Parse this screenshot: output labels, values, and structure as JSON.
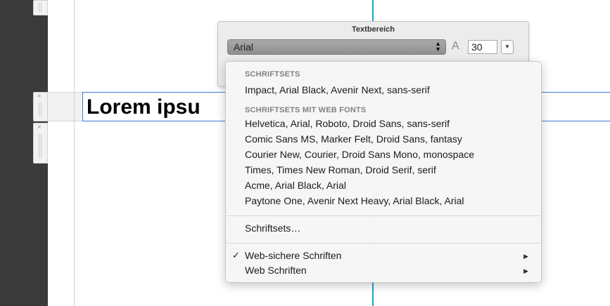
{
  "canvas": {
    "heading_text": "Lorem ipsu"
  },
  "panel": {
    "title": "Textbereich",
    "font_select_value": "Arial",
    "font_size_value": "30"
  },
  "menu": {
    "section1_header": "SCHRIFTSETS",
    "section1_items": [
      "Impact, Arial Black, Avenir Next, sans-serif"
    ],
    "section2_header": "SCHRIFTSETS MIT WEB FONTS",
    "section2_items": [
      "Helvetica, Arial, Roboto, Droid Sans, sans-serif",
      "Comic Sans MS, Marker Felt, Droid Sans, fantasy",
      "Courier New, Courier, Droid Sans Mono, monospace",
      "Times, Times New Roman, Droid Serif, serif",
      "Acme, Arial Black, Arial",
      "Paytone One, Avenir Next Heavy, Arial Black, Arial"
    ],
    "manage_item": "Schriftsets…",
    "submenus": [
      {
        "label": "Web-sichere Schriften",
        "checked": true
      },
      {
        "label": "Web Schriften",
        "checked": false
      }
    ]
  },
  "icons": {
    "close": "×",
    "check": "✓",
    "submenu_arrow": "▶",
    "stepper": "⬍",
    "size": "A"
  },
  "colors": {
    "accent_guide": "#3b7ad9",
    "cyan_guide": "#18a8c8",
    "dark_sidebar": "#3a3a3a"
  }
}
